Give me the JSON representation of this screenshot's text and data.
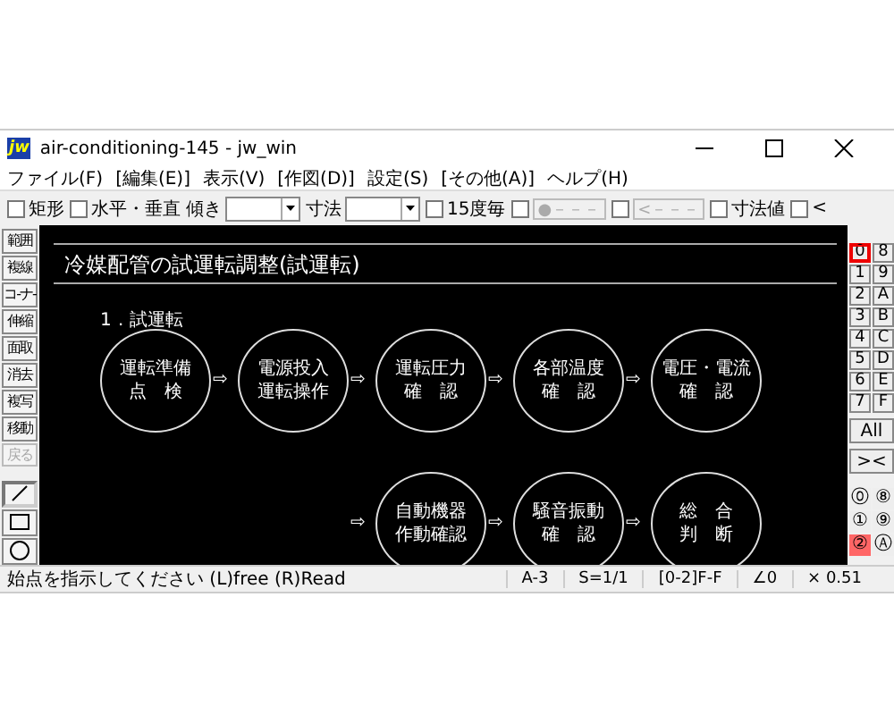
{
  "window": {
    "logo": "jw",
    "title": "air-conditioning-145 - jw_win"
  },
  "menu": [
    "ファイル(F)",
    "[編集(E)]",
    "表示(V)",
    "[作図(D)]",
    "設定(S)",
    "[その他(A)]",
    "ヘルプ(H)"
  ],
  "toolbar": [
    {
      "kind": "check",
      "label": "矩形",
      "checked": false
    },
    {
      "kind": "check",
      "label": "水平・垂直",
      "checked": false
    },
    {
      "kind": "combo",
      "label": "傾き"
    },
    {
      "kind": "combo",
      "label": "寸法"
    },
    {
      "kind": "check",
      "label": "15度毎",
      "checked": false
    },
    {
      "kind": "checkbtn",
      "label": "●－－－",
      "checked": false
    },
    {
      "kind": "checkbtn",
      "label": "<－－－",
      "checked": false
    },
    {
      "kind": "check",
      "label": "寸法値",
      "checked": false
    },
    {
      "kind": "check",
      "label": "<",
      "checked": false
    }
  ],
  "tools": [
    {
      "kind": "text",
      "label": "範囲",
      "disabled": false
    },
    {
      "kind": "text",
      "label": "複線",
      "disabled": false
    },
    {
      "kind": "text",
      "label": "コ-ナ-",
      "disabled": false
    },
    {
      "kind": "text",
      "label": "伸縮",
      "disabled": false
    },
    {
      "kind": "text",
      "label": "面取",
      "disabled": false
    },
    {
      "kind": "text",
      "label": "消去",
      "disabled": false
    },
    {
      "kind": "text",
      "label": "複写",
      "disabled": false
    },
    {
      "kind": "text",
      "label": "移動",
      "disabled": false
    },
    {
      "kind": "text",
      "label": "戻る",
      "disabled": true
    },
    {
      "kind": "line",
      "selected": true
    },
    {
      "kind": "rect",
      "selected": false
    },
    {
      "kind": "circle",
      "selected": false
    }
  ],
  "drawing": {
    "heading": "冷媒配管の試運転調整(試運転)",
    "section": "1．試運転",
    "steps": [
      {
        "lines": [
          "運転準備",
          "点　検"
        ]
      },
      {
        "lines": [
          "電源投入",
          "運転操作"
        ]
      },
      {
        "lines": [
          "運転圧力",
          "確　認"
        ]
      },
      {
        "lines": [
          "各部温度",
          "確　認"
        ]
      },
      {
        "lines": [
          "電圧・電流",
          "確　認"
        ]
      },
      {
        "lines": [
          "自動機器",
          "作動確認"
        ]
      },
      {
        "lines": [
          "騒音振動",
          "確　認"
        ]
      },
      {
        "lines": [
          "総　合",
          "判　断"
        ]
      }
    ],
    "arrow": "⇨"
  },
  "layers": [
    {
      "label": "0",
      "selected": true
    },
    {
      "label": "8",
      "selected": false
    },
    {
      "label": "1",
      "selected": false
    },
    {
      "label": "9",
      "selected": false
    },
    {
      "label": "2",
      "selected": false
    },
    {
      "label": "A",
      "selected": false
    },
    {
      "label": "3",
      "selected": false
    },
    {
      "label": "B",
      "selected": false
    },
    {
      "label": "4",
      "selected": false
    },
    {
      "label": "C",
      "selected": false
    },
    {
      "label": "5",
      "selected": false
    },
    {
      "label": "D",
      "selected": false
    },
    {
      "label": "6",
      "selected": false
    },
    {
      "label": "E",
      "selected": false
    },
    {
      "label": "7",
      "selected": false
    },
    {
      "label": "F",
      "selected": false
    }
  ],
  "layer_all": "All",
  "layer_swap": "><",
  "groups": [
    {
      "label": "⓪",
      "selected": false
    },
    {
      "label": "⑧",
      "selected": false
    },
    {
      "label": "①",
      "selected": false
    },
    {
      "label": "⑨",
      "selected": false
    },
    {
      "label": "②",
      "selected": true
    },
    {
      "label": "Ⓐ",
      "selected": false
    }
  ],
  "status_bar": {
    "message": "始点を指示してください (L)free (R)Read",
    "cells": [
      "A-3",
      "S=1/1",
      "[0-2]F-F",
      "∠0",
      "× 0.51"
    ]
  }
}
